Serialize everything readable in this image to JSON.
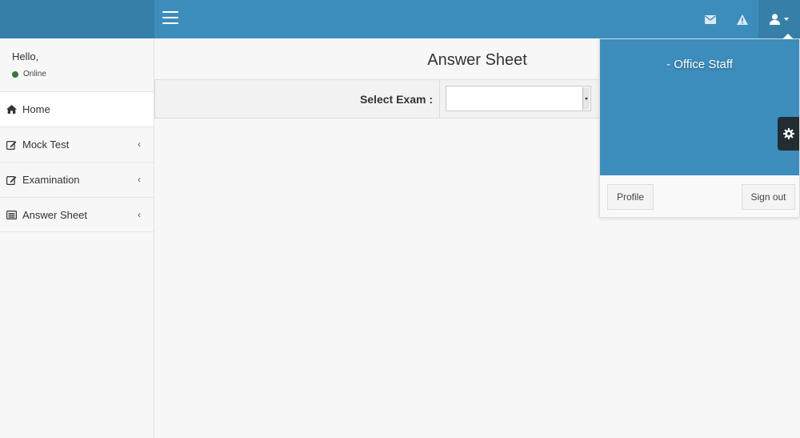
{
  "navbar": {
    "icons": [
      "bars-icon",
      "envelope-icon",
      "warning-icon",
      "user-icon"
    ]
  },
  "sidebar": {
    "greeting": "Hello,",
    "status": "Online",
    "items": [
      {
        "label": "Home",
        "icon": "home-icon",
        "active": true
      },
      {
        "label": "Mock Test",
        "icon": "edit-icon"
      },
      {
        "label": "Examination",
        "icon": "edit-icon"
      },
      {
        "label": "Answer Sheet",
        "icon": "list-alt-icon"
      }
    ]
  },
  "main": {
    "title": "Answer Sheet",
    "exam_label": "Select Exam :",
    "exam_value": ""
  },
  "user_menu": {
    "role": "- Office Staff",
    "profile_label": "Profile",
    "signout_label": "Sign out"
  },
  "colors": {
    "primary": "#3c8dbc",
    "primary_dark": "#367fa9",
    "online": "#3c763d",
    "gear_tab": "#222d32"
  }
}
